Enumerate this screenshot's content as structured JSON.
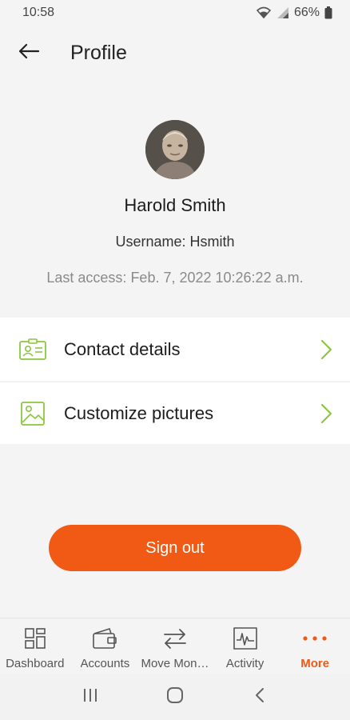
{
  "status_bar": {
    "time": "10:58",
    "battery": "66%",
    "icons": [
      "wifi-icon",
      "signal-icon",
      "battery-icon"
    ]
  },
  "header": {
    "title": "Profile",
    "back_icon": "back-arrow-icon"
  },
  "profile": {
    "name": "Harold Smith",
    "username": "Username: Hsmith",
    "last_access": "Last access: Feb. 7, 2022 10:26:22 a.m."
  },
  "menu": {
    "items": [
      {
        "label": "Contact details",
        "icon": "contact-card-icon"
      },
      {
        "label": "Customize pictures",
        "icon": "picture-icon"
      }
    ]
  },
  "sign_out": {
    "label": "Sign out"
  },
  "bottom_nav": {
    "items": [
      {
        "label": "Dashboard",
        "icon": "dashboard-icon"
      },
      {
        "label": "Accounts",
        "icon": "wallet-icon"
      },
      {
        "label": "Move Mon…",
        "icon": "transfer-icon"
      },
      {
        "label": "Activity",
        "icon": "activity-icon"
      },
      {
        "label": "More",
        "icon": "more-dots-icon",
        "active": true
      }
    ]
  },
  "colors": {
    "accent": "#f05a14",
    "icon_green": "#8cc63f",
    "background": "#f4f4f4"
  }
}
